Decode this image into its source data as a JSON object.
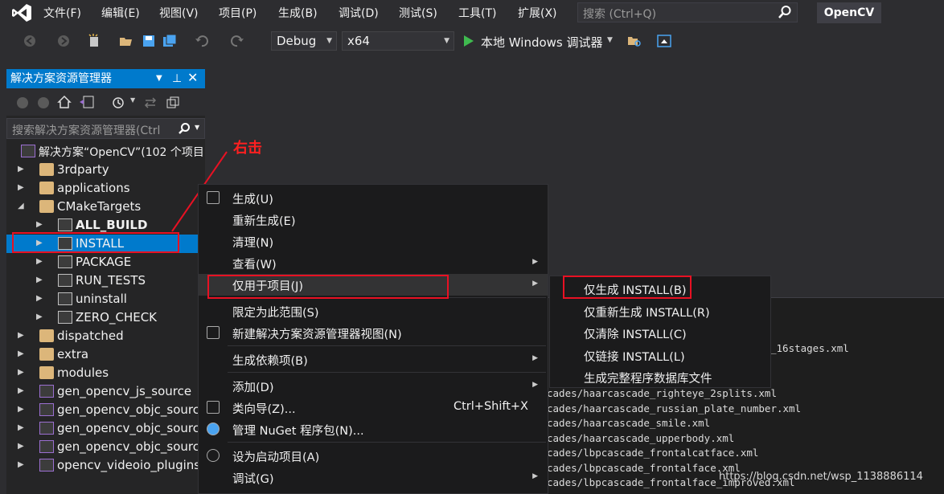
{
  "menubar": {
    "items": [
      "文件(F)",
      "编辑(E)",
      "视图(V)",
      "项目(P)",
      "生成(B)",
      "调试(D)",
      "测试(S)",
      "工具(T)",
      "扩展(X)"
    ],
    "search_placeholder": "搜索 (Ctrl+Q)",
    "solution_name": "OpenCV"
  },
  "toolbar": {
    "config": "Debug",
    "platform": "x64",
    "run_label": "本地 Windows 调试器"
  },
  "solution_explorer": {
    "title": "解决方案资源管理器",
    "search_placeholder": "搜索解决方案资源管理器(Ctrl",
    "tree": [
      {
        "label": "解决方案“OpenCV”(102 个项目",
        "depth": 0,
        "kind": "solution",
        "expand": ""
      },
      {
        "label": "3rdparty",
        "depth": 1,
        "kind": "folder",
        "expand": "▶"
      },
      {
        "label": "applications",
        "depth": 1,
        "kind": "folder",
        "expand": "▶"
      },
      {
        "label": "CMakeTargets",
        "depth": 1,
        "kind": "folder",
        "expand": "◢"
      },
      {
        "label": "ALL_BUILD",
        "depth": 2,
        "kind": "cmake",
        "expand": "▶",
        "bold": true
      },
      {
        "label": "INSTALL",
        "depth": 2,
        "kind": "cmake",
        "expand": "▶",
        "selected": true
      },
      {
        "label": "PACKAGE",
        "depth": 2,
        "kind": "cmake",
        "expand": "▶"
      },
      {
        "label": "RUN_TESTS",
        "depth": 2,
        "kind": "cmake",
        "expand": "▶"
      },
      {
        "label": "uninstall",
        "depth": 2,
        "kind": "cmake",
        "expand": "▶"
      },
      {
        "label": "ZERO_CHECK",
        "depth": 2,
        "kind": "cmake",
        "expand": "▶"
      },
      {
        "label": "dispatched",
        "depth": 1,
        "kind": "folder",
        "expand": "▶"
      },
      {
        "label": "extra",
        "depth": 1,
        "kind": "folder",
        "expand": "▶"
      },
      {
        "label": "modules",
        "depth": 1,
        "kind": "folder",
        "expand": "▶"
      },
      {
        "label": "gen_opencv_js_source",
        "depth": 1,
        "kind": "project",
        "expand": "▶"
      },
      {
        "label": "gen_opencv_objc_source",
        "depth": 1,
        "kind": "project",
        "expand": "▶"
      },
      {
        "label": "gen_opencv_objc_source",
        "depth": 1,
        "kind": "project",
        "expand": "▶"
      },
      {
        "label": "gen_opencv_objc_source",
        "depth": 1,
        "kind": "project",
        "expand": "▶"
      },
      {
        "label": "opencv_videoio_plugins",
        "depth": 1,
        "kind": "project",
        "expand": "▶"
      }
    ]
  },
  "annotation": "右击",
  "context_menu": {
    "items": [
      {
        "label": "生成(U)",
        "icon": "build-icon"
      },
      {
        "label": "重新生成(E)"
      },
      {
        "label": "清理(N)"
      },
      {
        "label": "查看(W)",
        "submenu": true
      },
      {
        "label": "仅用于项目(J)",
        "submenu": true,
        "highlight": true,
        "sep_after": true
      },
      {
        "label": "限定为此范围(S)"
      },
      {
        "label": "新建解决方案资源管理器视图(N)",
        "icon": "new-view-icon",
        "sep_after": true
      },
      {
        "label": "生成依赖项(B)",
        "submenu": true,
        "sep_after": true
      },
      {
        "label": "添加(D)",
        "submenu": true
      },
      {
        "label": "类向导(Z)...",
        "shortcut": "Ctrl+Shift+X",
        "icon": "class-wizard-icon"
      },
      {
        "label": "管理 NuGet 程序包(N)...",
        "icon": "nuget-icon",
        "sep_after": true
      },
      {
        "label": "设为启动项目(A)",
        "icon": "gear-icon"
      },
      {
        "label": "调试(G)",
        "submenu": true
      }
    ]
  },
  "submenu": {
    "items": [
      "仅生成 INSTALL(B)",
      "仅重新生成 INSTALL(R)",
      "仅清除 INSTALL(C)",
      "仅链接 INSTALL(L)",
      "生成完整程序数据库文件"
    ]
  },
  "output": {
    "lines": [
      "_16stages.xml",
      "cades/haarcascade_righteye_2splits.xml",
      "cades/haarcascade_russian_plate_number.xml",
      "cades/haarcascade_smile.xml",
      "cades/haarcascade_upperbody.xml",
      "cades/lbpcascade_frontalcatface.xml",
      "cades/lbpcascade_frontalface.xml",
      "cades/lbpcascade_frontalface_improved.xml"
    ]
  },
  "watermark": "https://blog.csdn.net/wsp_1138886114",
  "colors": {
    "accent": "#007acc",
    "annotation": "#e81123"
  }
}
